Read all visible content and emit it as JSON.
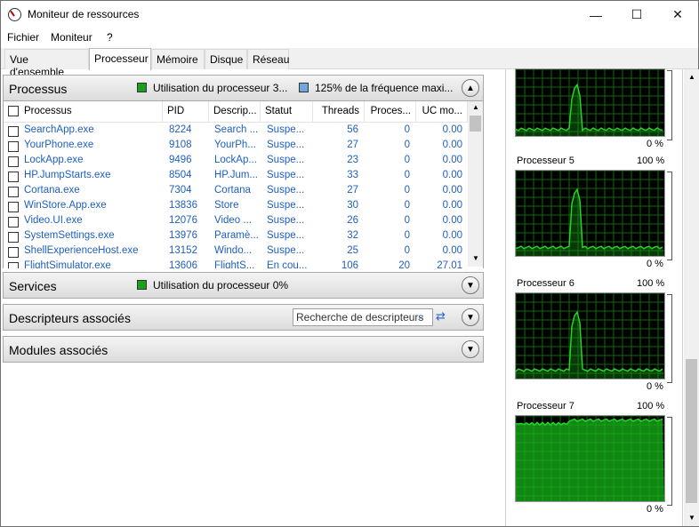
{
  "window": {
    "title": "Moniteur de ressources"
  },
  "menu": [
    "Fichier",
    "Moniteur",
    "?"
  ],
  "tabs": [
    "Vue d'ensemble",
    "Processeur",
    "Mémoire",
    "Disque",
    "Réseau"
  ],
  "active_tab": "Processeur",
  "colors": {
    "accent_green": "#1aa01a",
    "freq_blue": "#6fa8dc",
    "link_blue": "#1e5fc1"
  },
  "processus": {
    "title": "Processus",
    "legend_cpu": "Utilisation du processeur 3...",
    "legend_freq": "125% de la fréquence maxi...",
    "columns": [
      "Processus",
      "PID",
      "Descrip...",
      "Statut",
      "Threads",
      "Proces...",
      "UC mo..."
    ],
    "rows": [
      {
        "name": "SearchApp.exe",
        "pid": "8224",
        "desc": "Search ...",
        "status": "Suspe...",
        "threads": "56",
        "proc": "0",
        "cpu": "0.00"
      },
      {
        "name": "YourPhone.exe",
        "pid": "9108",
        "desc": "YourPh...",
        "status": "Suspe...",
        "threads": "27",
        "proc": "0",
        "cpu": "0.00"
      },
      {
        "name": "LockApp.exe",
        "pid": "9496",
        "desc": "LockAp...",
        "status": "Suspe...",
        "threads": "23",
        "proc": "0",
        "cpu": "0.00"
      },
      {
        "name": "HP.JumpStarts.exe",
        "pid": "8504",
        "desc": "HP.Jum...",
        "status": "Suspe...",
        "threads": "33",
        "proc": "0",
        "cpu": "0.00"
      },
      {
        "name": "Cortana.exe",
        "pid": "7304",
        "desc": "Cortana",
        "status": "Suspe...",
        "threads": "27",
        "proc": "0",
        "cpu": "0.00"
      },
      {
        "name": "WinStore.App.exe",
        "pid": "13836",
        "desc": "Store",
        "status": "Suspe...",
        "threads": "30",
        "proc": "0",
        "cpu": "0.00"
      },
      {
        "name": "Video.UI.exe",
        "pid": "12076",
        "desc": "Video ...",
        "status": "Suspe...",
        "threads": "26",
        "proc": "0",
        "cpu": "0.00"
      },
      {
        "name": "SystemSettings.exe",
        "pid": "13976",
        "desc": "Paramè...",
        "status": "Suspe...",
        "threads": "32",
        "proc": "0",
        "cpu": "0.00"
      },
      {
        "name": "ShellExperienceHost.exe",
        "pid": "13152",
        "desc": "Windo...",
        "status": "Suspe...",
        "threads": "25",
        "proc": "0",
        "cpu": "0.00"
      },
      {
        "name": "FlightSimulator.exe",
        "pid": "13606",
        "desc": "FlightS...",
        "status": "En cou...",
        "threads": "106",
        "proc": "20",
        "cpu": "27.01"
      }
    ]
  },
  "services": {
    "title": "Services",
    "legend": "Utilisation du processeur 0%"
  },
  "descripteurs": {
    "title": "Descripteurs associés",
    "search_placeholder": "Recherche de descripteurs"
  },
  "modules": {
    "title": "Modules associés"
  },
  "graphs": [
    {
      "label": "",
      "max": "",
      "min": "0 %",
      "level_pct": 10,
      "spike": true
    },
    {
      "label": "Processeur 5",
      "max": "100 %",
      "min": "0 %",
      "level_pct": 10,
      "spike": true
    },
    {
      "label": "Processeur 6",
      "max": "100 %",
      "min": "0 %",
      "level_pct": 10,
      "spike": true
    },
    {
      "label": "Processeur 7",
      "max": "100 %",
      "min": "0 %",
      "level_pct": 95,
      "spike": false
    }
  ]
}
